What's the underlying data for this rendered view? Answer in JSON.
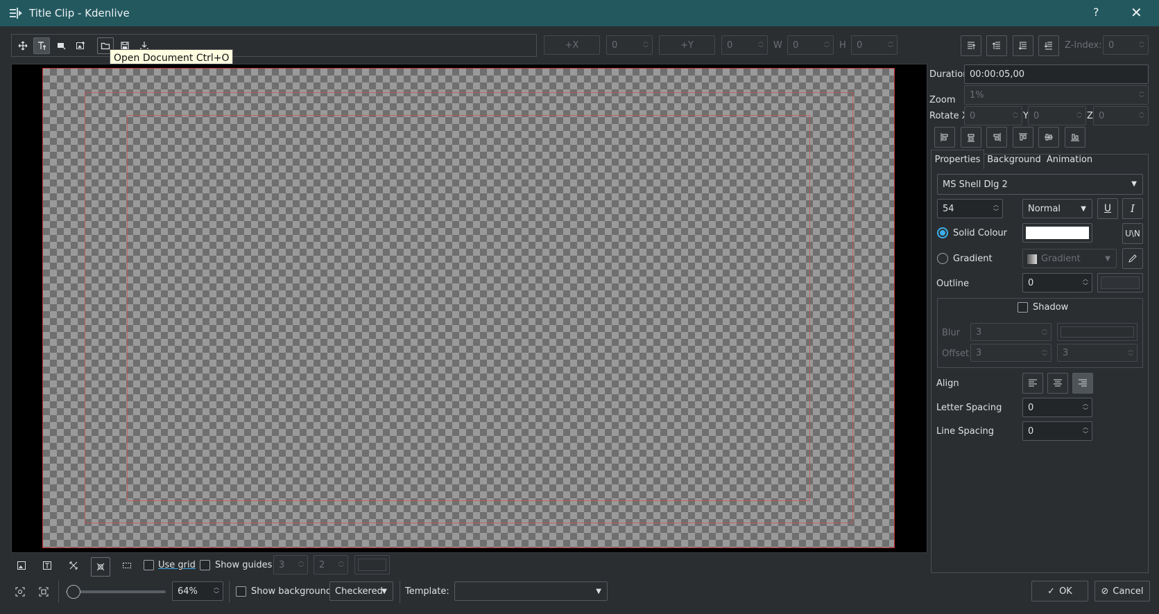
{
  "window": {
    "title": "Title Clip - Kdenlive",
    "help_glyph": "?",
    "close_glyph": "✕"
  },
  "tooltip": "Open Document Ctrl+O",
  "toolbar": {
    "plus_x_label": "+X",
    "x_value": "0",
    "plus_y_label": "+Y",
    "y_value": "0",
    "w_label": "W",
    "w_value": "0",
    "h_label": "H",
    "h_value": "0",
    "zindex_label": "Z-Index:",
    "zindex_value": "0"
  },
  "props": {
    "duration_label": "Duration",
    "duration_value": "00:00:05,00",
    "zoom_label": "Zoom",
    "zoom_value": "1%",
    "rotate_x_label": "Rotate X",
    "rotate_x_value": "0",
    "rotate_y_label": "Y",
    "rotate_y_value": "0",
    "rotate_z_label": "Z",
    "rotate_z_value": "0"
  },
  "tabs": [
    "Properties",
    "Background",
    "Animation"
  ],
  "text_props": {
    "font_family": "MS Shell Dlg 2",
    "font_size": "54",
    "font_weight": "Normal",
    "solid_colour_label": "Solid Colour",
    "solid_colour": "#ffffff",
    "gradient_label": "Gradient",
    "gradient_combo": "Gradient",
    "outline_label": "Outline",
    "outline_value": "0",
    "shadow_label": "Shadow",
    "blur_label": "Blur",
    "blur_value": "3",
    "offset_label": "Offset",
    "offset_x": "3",
    "offset_y": "3",
    "align_label": "Align",
    "letter_spacing_label": "Letter Spacing",
    "letter_spacing_value": "0",
    "line_spacing_label": "Line Spacing",
    "line_spacing_value": "0"
  },
  "bottom": {
    "use_grid_label": "Use grid",
    "show_guides_label": "Show guides",
    "guides_h": "3",
    "guides_v": "2",
    "zoom_percent": "64%",
    "show_background_label": "Show background",
    "background_style": "Checkered",
    "template_label": "Template:",
    "template_value": "",
    "ok_label": "OK",
    "cancel_label": "Cancel"
  },
  "colors": {
    "titlebar": "#23585f",
    "accent": "#3daee9",
    "frame_border": "#c43333"
  }
}
